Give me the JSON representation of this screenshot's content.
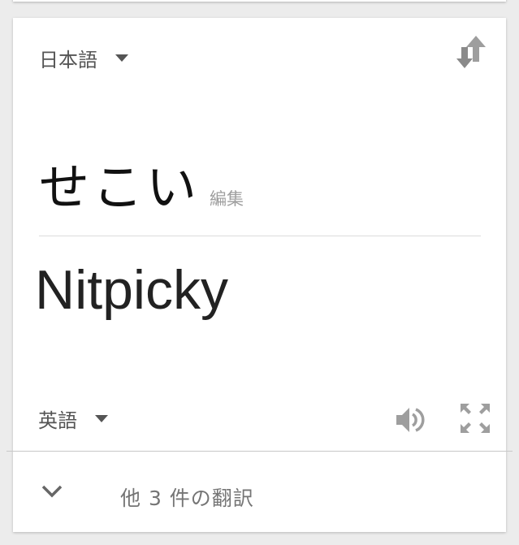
{
  "source": {
    "language": "日本語",
    "text": "せこい",
    "edit_label": "編集"
  },
  "target": {
    "language": "英語",
    "text": "Nitpicky"
  },
  "more_translations": {
    "label": "他 3 件の翻訳"
  },
  "icons": {
    "swap": "swap-vert-icon",
    "speaker": "volume-icon",
    "fullscreen": "fullscreen-icon",
    "caret": "caret-down-icon",
    "expand": "chevron-down-icon"
  },
  "colors": {
    "card_bg": "#ffffff",
    "page_bg": "#ececec",
    "icon_gray": "#9e9e9e",
    "text_dark": "#222222"
  }
}
